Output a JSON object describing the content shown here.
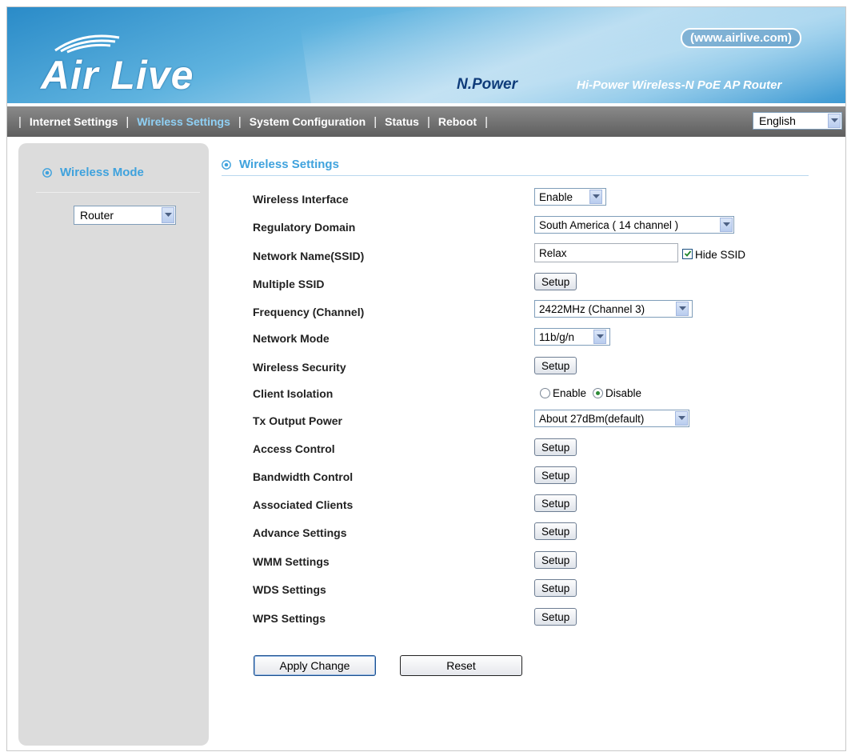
{
  "header": {
    "logo_text": "Air Live",
    "url_badge": "www.airlive.com",
    "brand_series": "N.Power",
    "product_name": "Hi-Power Wireless-N PoE AP Router",
    "gradient_colors": [
      "#2a8bc8",
      "#a9d5ee",
      "#3f9ad3"
    ]
  },
  "nav": {
    "items": [
      {
        "label": "Internet Settings",
        "active": false
      },
      {
        "label": "Wireless Settings",
        "active": true
      },
      {
        "label": "System Configuration",
        "active": false
      },
      {
        "label": "Status",
        "active": false
      },
      {
        "label": "Reboot",
        "active": false
      }
    ],
    "separator": "|",
    "language_selected": "English",
    "active_color": "#8fd0f5"
  },
  "sidebar": {
    "title": "Wireless Mode",
    "mode_selected": "Router"
  },
  "main": {
    "title": "Wireless Settings",
    "accent_color": "#3fa2dd",
    "rows": {
      "wireless_interface": {
        "label": "Wireless Interface",
        "value": "Enable"
      },
      "regulatory_domain": {
        "label": "Regulatory Domain",
        "value": "South America ( 14 channel )"
      },
      "ssid": {
        "label": "Network Name(SSID)",
        "value": "Relax",
        "hide_ssid_label": "Hide SSID",
        "hide_ssid_checked": true
      },
      "multiple_ssid": {
        "label": "Multiple SSID",
        "button": "Setup"
      },
      "frequency": {
        "label": "Frequency (Channel)",
        "value": "2422MHz (Channel 3)"
      },
      "network_mode": {
        "label": "Network Mode",
        "value": "11b/g/n"
      },
      "wireless_security": {
        "label": "Wireless Security",
        "button": "Setup"
      },
      "client_isolation": {
        "label": "Client Isolation",
        "enable_label": "Enable",
        "disable_label": "Disable",
        "selected": "Disable"
      },
      "tx_power": {
        "label": "Tx Output Power",
        "value": "About 27dBm(default)"
      },
      "access_control": {
        "label": "Access Control",
        "button": "Setup"
      },
      "bandwidth_control": {
        "label": "Bandwidth Control",
        "button": "Setup"
      },
      "associated_clients": {
        "label": "Associated Clients",
        "button": "Setup"
      },
      "advance_settings": {
        "label": "Advance Settings",
        "button": "Setup"
      },
      "wmm_settings": {
        "label": "WMM Settings",
        "button": "Setup"
      },
      "wds_settings": {
        "label": "WDS Settings",
        "button": "Setup"
      },
      "wps_settings": {
        "label": "WPS Settings",
        "button": "Setup"
      }
    },
    "apply_label": "Apply Change",
    "reset_label": "Reset"
  }
}
